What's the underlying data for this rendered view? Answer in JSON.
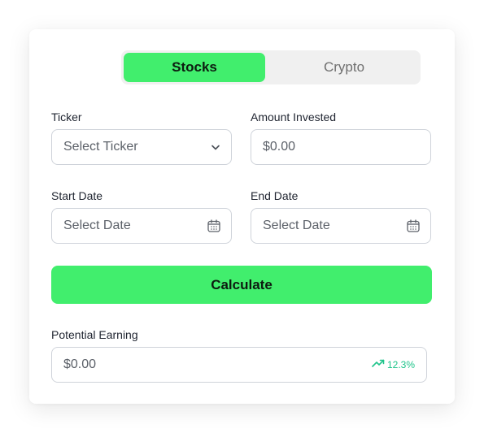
{
  "tabs": {
    "stocks_label": "Stocks",
    "crypto_label": "Crypto",
    "active": "Stocks"
  },
  "form": {
    "ticker": {
      "label": "Ticker",
      "placeholder": "Select Ticker",
      "icon": "chevron-down-icon"
    },
    "amount": {
      "label": "Amount Invested",
      "placeholder": "$0.00"
    },
    "start_date": {
      "label": "Start Date",
      "placeholder": "Select Date",
      "icon": "calendar-icon"
    },
    "end_date": {
      "label": "End Date",
      "placeholder": "Select Date",
      "icon": "calendar-icon"
    }
  },
  "calculate_label": "Calculate",
  "result": {
    "label": "Potential Earning",
    "value": "$0.00",
    "change": "12.3%",
    "change_icon": "trending-up-icon"
  },
  "colors": {
    "accent": "#41ee6d",
    "growth": "#1ec48a",
    "tab_track": "#f0f0f0"
  }
}
